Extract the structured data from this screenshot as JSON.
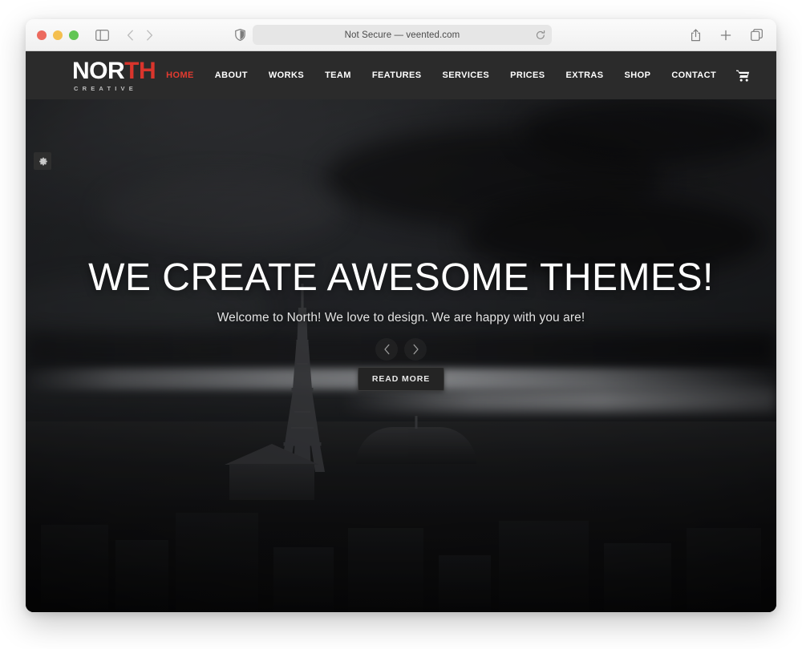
{
  "browser": {
    "traffic_lights": [
      "close",
      "minimize",
      "maximize"
    ],
    "url_text": "Not Secure — veented.com",
    "url_placeholder": "Search or enter website name",
    "icons": {
      "sidebar": "sidebar-icon",
      "back": "back-arrow-icon",
      "forward": "forward-arrow-icon",
      "shield": "privacy-shield-icon",
      "reload": "reload-icon",
      "share": "share-icon",
      "new_tab": "plus-icon",
      "tabs": "tab-overview-icon"
    }
  },
  "site": {
    "logo": {
      "part_white": "NOR",
      "part_red": "TH",
      "tagline": "CREATIVE",
      "red_hex": "#d9352c"
    },
    "nav": [
      {
        "label": "HOME",
        "active": true
      },
      {
        "label": "ABOUT",
        "active": false
      },
      {
        "label": "WORKS",
        "active": false
      },
      {
        "label": "TEAM",
        "active": false
      },
      {
        "label": "FEATURES",
        "active": false
      },
      {
        "label": "SERVICES",
        "active": false
      },
      {
        "label": "PRICES",
        "active": false
      },
      {
        "label": "EXTRAS",
        "active": false
      },
      {
        "label": "SHOP",
        "active": false
      },
      {
        "label": "CONTACT",
        "active": false
      }
    ],
    "cart_icon": "shopping-cart-icon",
    "settings_tab_icon": "gear-icon",
    "hero": {
      "title": "WE CREATE AWESOME THEMES!",
      "subtitle": "Welcome to North! We love to design. We are happy with you are!",
      "prev_icon": "chevron-left-icon",
      "next_icon": "chevron-right-icon",
      "cta_label": "READ MORE",
      "background_description": "Dark monochrome Paris skyline with Eiffel Tower under storm clouds"
    }
  }
}
